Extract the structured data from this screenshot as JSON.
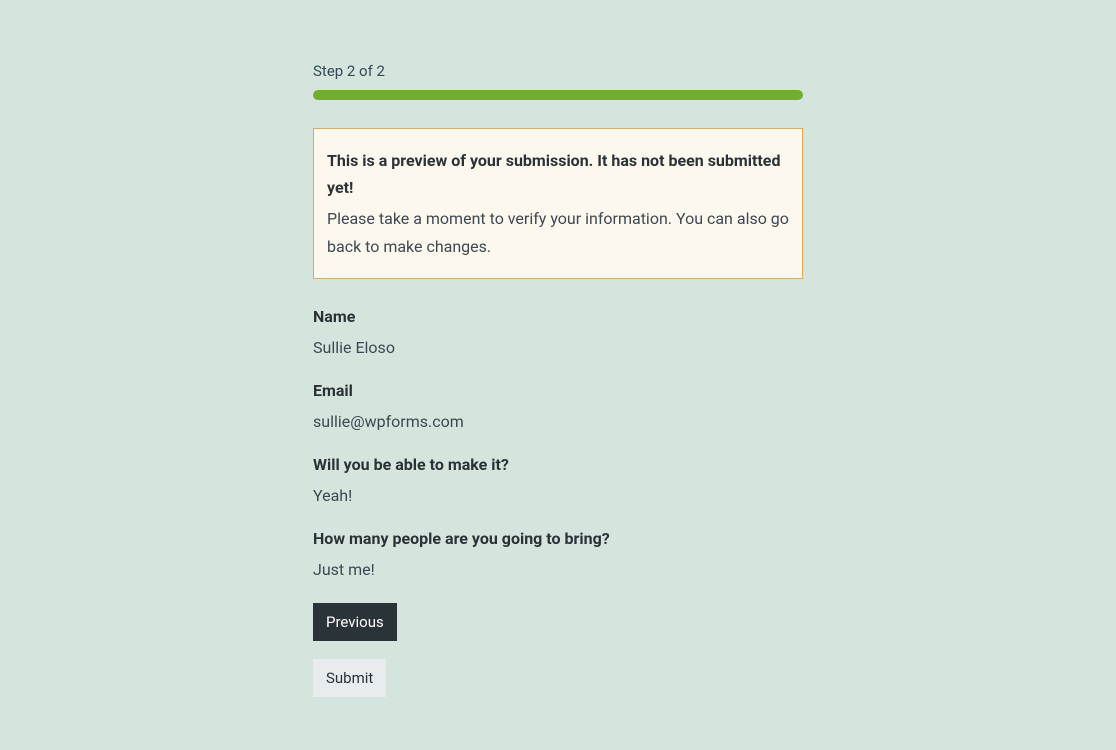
{
  "step": {
    "label": "Step 2 of 2"
  },
  "notice": {
    "title": "This is a preview of your submission. It has not been submitted yet!",
    "text": "Please take a moment to verify your information. You can also go back to make changes."
  },
  "fields": {
    "name": {
      "label": "Name",
      "value": "Sullie Eloso"
    },
    "email": {
      "label": "Email",
      "value": "sullie@wpforms.com"
    },
    "attendance": {
      "label": "Will you be able to make it?",
      "value": "Yeah!"
    },
    "guests": {
      "label": "How many people are you going to bring?",
      "value": "Just me!"
    }
  },
  "buttons": {
    "previous": "Previous",
    "submit": "Submit"
  }
}
